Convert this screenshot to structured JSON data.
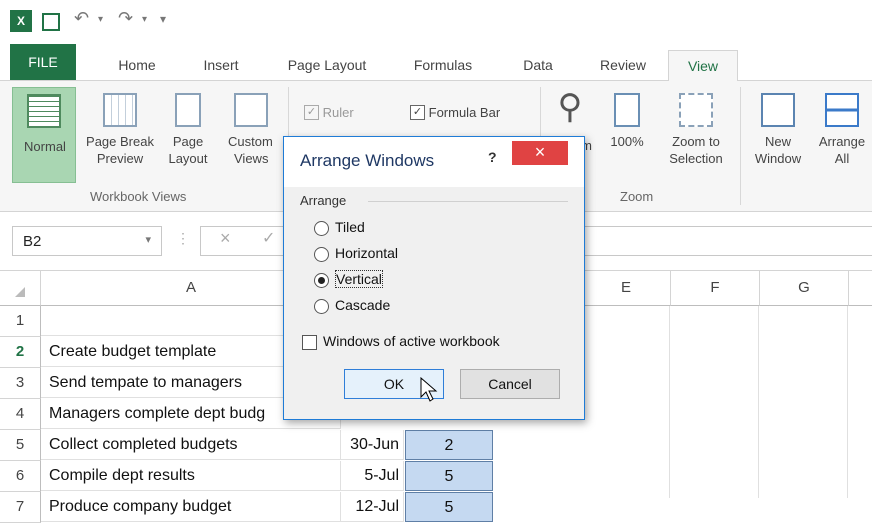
{
  "tabs": [
    "FILE",
    "Home",
    "Insert",
    "Page Layout",
    "Formulas",
    "Data",
    "Review",
    "View"
  ],
  "ribbon": {
    "normal": "Normal",
    "page_break_1": "Page Break",
    "page_break_2": "Preview",
    "page_layout_1": "Page",
    "page_layout_2": "Layout",
    "custom_1": "Custom",
    "custom_2": "Views",
    "group_workbook_views": "Workbook Views",
    "ruler": "Ruler",
    "formula_bar": "Formula Bar",
    "zoom_partial": "m",
    "zoom_100": "100%",
    "zoom_sel_1": "Zoom to",
    "zoom_sel_2": "Selection",
    "group_zoom": "Zoom",
    "new_window_1": "New",
    "new_window_2": "Window",
    "arrange_1": "Arrange",
    "arrange_2": "All"
  },
  "formula_bar": {
    "name_box": "B2"
  },
  "columns": [
    "A",
    "E",
    "F",
    "G"
  ],
  "rows": [
    {
      "num": "1",
      "a": "",
      "b": "",
      "c": ""
    },
    {
      "num": "2",
      "a": "Create budget template",
      "b": "",
      "c": ""
    },
    {
      "num": "3",
      "a": "Send tempate to managers",
      "b": "",
      "c": ""
    },
    {
      "num": "4",
      "a": "Managers complete dept budg",
      "b": "",
      "c": ""
    },
    {
      "num": "5",
      "a": "Collect completed budgets",
      "b": "30-Jun",
      "c": "2"
    },
    {
      "num": "6",
      "a": "Compile dept results",
      "b": "5-Jul",
      "c": "5"
    },
    {
      "num": "7",
      "a": "Produce company budget",
      "b": "12-Jul",
      "c": "5"
    }
  ],
  "dialog": {
    "title": "Arrange Windows",
    "help": "?",
    "close": "×",
    "group": "Arrange",
    "options": [
      "Tiled",
      "Horizontal",
      "Vertical",
      "Cascade"
    ],
    "selected": "Vertical",
    "checkbox": "Windows of active workbook",
    "ok": "OK",
    "cancel": "Cancel"
  },
  "colors": {
    "excel_green": "#217346",
    "selection_blue": "#c5d9f1",
    "dialog_close_red": "#e04343"
  }
}
